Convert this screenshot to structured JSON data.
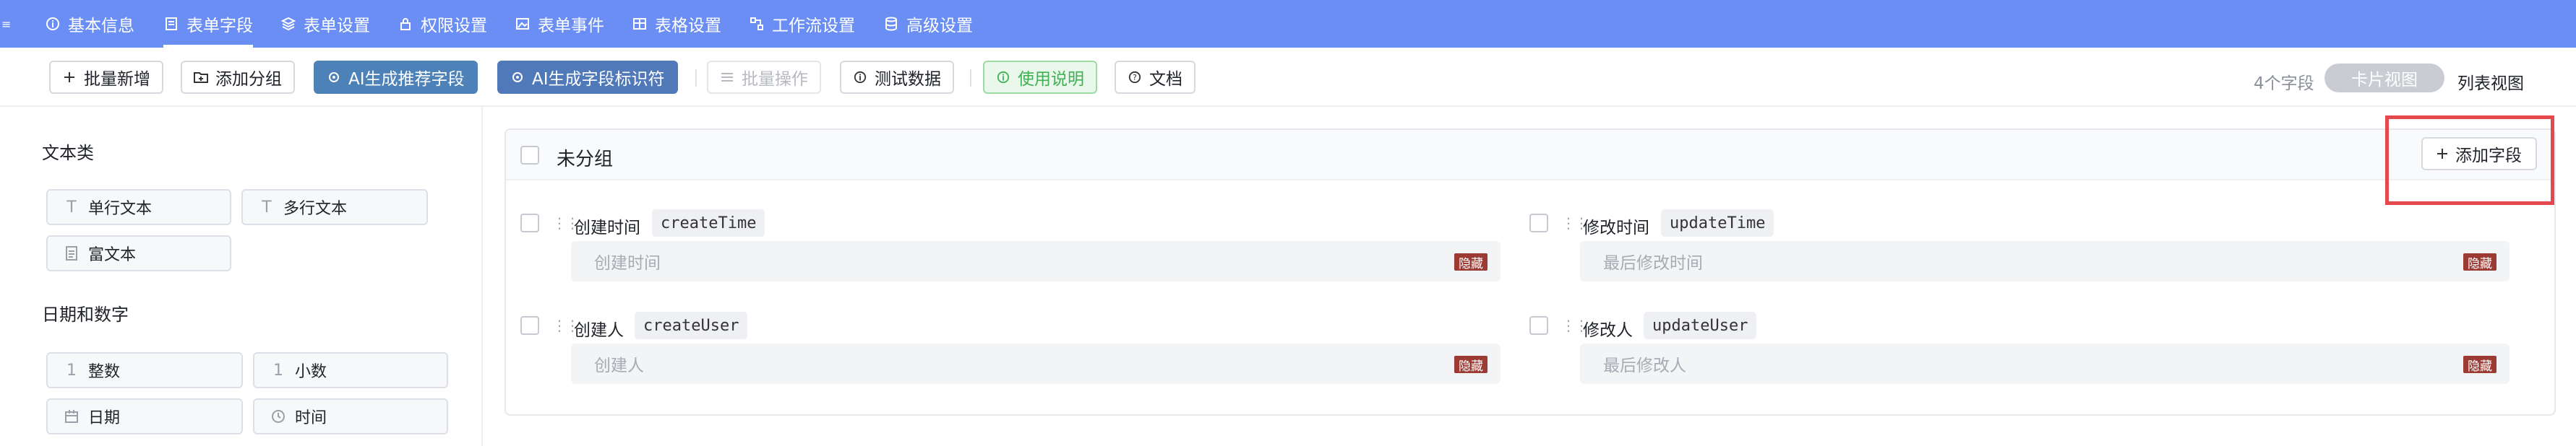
{
  "nav": {
    "tabs": [
      {
        "label": "基本信息",
        "icon": "info-circle-icon"
      },
      {
        "label": "表单字段",
        "icon": "form-icon"
      },
      {
        "label": "表单设置",
        "icon": "layers-icon"
      },
      {
        "label": "权限设置",
        "icon": "lock-icon"
      },
      {
        "label": "表单事件",
        "icon": "image-icon"
      },
      {
        "label": "表格设置",
        "icon": "table-icon"
      },
      {
        "label": "工作流设置",
        "icon": "workflow-icon"
      },
      {
        "label": "高级设置",
        "icon": "database-icon"
      }
    ],
    "active_index": 1
  },
  "toolbar": {
    "batch_add": "批量新增",
    "add_group": "添加分组",
    "ai_recommend": "AI生成推荐字段",
    "ai_identifier": "AI生成字段标识符",
    "batch_ops": "批量操作",
    "test_data": "测试数据",
    "usage": "使用说明",
    "docs": "文档",
    "field_count": "4个字段",
    "card_view": "卡片视图",
    "list_view": "列表视图"
  },
  "palette": {
    "text_category": "文本类",
    "single_line": "单行文本",
    "multi_line": "多行文本",
    "rich_text": "富文本",
    "date_num_category": "日期和数字",
    "integer": "整数",
    "decimal": "小数",
    "date": "日期",
    "time": "时间"
  },
  "group": {
    "title": "未分组",
    "add_field": "添加字段",
    "fields": [
      {
        "label": "创建时间",
        "code": "createTime",
        "placeholder": "创建时间",
        "badge": "隐藏"
      },
      {
        "label": "修改时间",
        "code": "updateTime",
        "placeholder": "最后修改时间",
        "badge": "隐藏"
      },
      {
        "label": "创建人",
        "code": "createUser",
        "placeholder": "创建人",
        "badge": "隐藏"
      },
      {
        "label": "修改人",
        "code": "updateUser",
        "placeholder": "最后修改人",
        "badge": "隐藏"
      }
    ]
  },
  "colors": {
    "nav_bg": "#6b8ef4",
    "ai_button": "#4d82b8",
    "usage_green": "#3fb152",
    "hidden_badge": "#9c3b34",
    "highlight_red": "#e5484d"
  }
}
